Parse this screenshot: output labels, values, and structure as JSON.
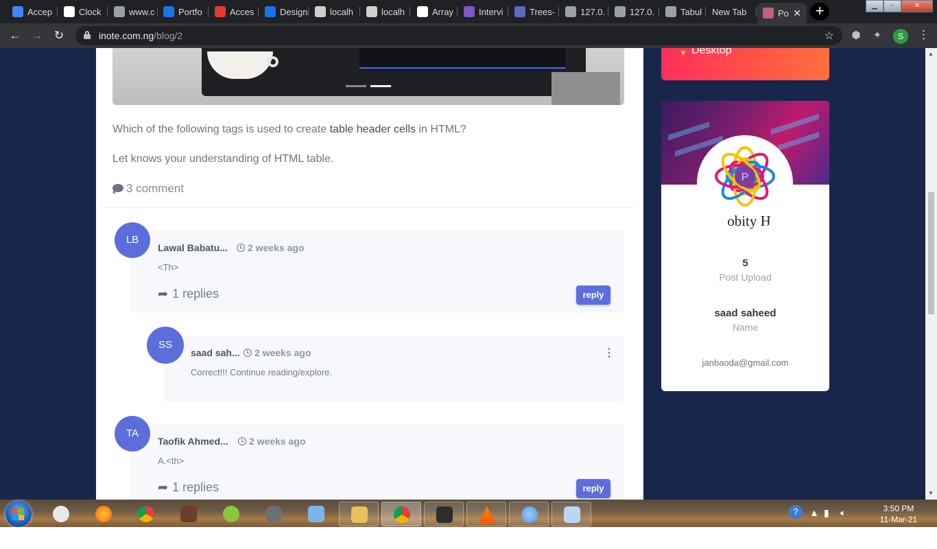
{
  "browser": {
    "tabs": [
      {
        "label": "Accep",
        "color": "#4285f4"
      },
      {
        "label": "Clock",
        "color": "#ffffff"
      },
      {
        "label": "www.c",
        "color": "#9aa0a6"
      },
      {
        "label": "Portfo",
        "color": "#1a73e8"
      },
      {
        "label": "Acces",
        "color": "#e53935"
      },
      {
        "label": "Design",
        "color": "#1a73e8"
      },
      {
        "label": "localh",
        "color": "#cfcfcf"
      },
      {
        "label": "localh",
        "color": "#cfcfcf"
      },
      {
        "label": "Array",
        "color": "#ffffff"
      },
      {
        "label": "Intervi",
        "color": "#7e57c2"
      },
      {
        "label": "Trees-",
        "color": "#5c6bc0"
      },
      {
        "label": "127.0.",
        "color": "#9aa0a6"
      },
      {
        "label": "127.0.",
        "color": "#9aa0a6"
      },
      {
        "label": "Tabul",
        "color": "#9aa0a6"
      },
      {
        "label": "New Tab",
        "color": ""
      },
      {
        "label": "Po",
        "color": "#c06080"
      }
    ],
    "new_tab_symbol": "+",
    "url_host": "inote.com.ng",
    "url_path": "/blog/2",
    "profile_initial": "S"
  },
  "post": {
    "question_prefix": "Which of the following tags is used to create ",
    "question_highlight": "table header cells",
    "question_suffix": " in HTML?",
    "description": "Let knows your understanding of HTML table.",
    "comment_count": "3 comment"
  },
  "comments": [
    {
      "initials": "LB",
      "name": "Lawal Babatu...",
      "time": "2 weeks ago",
      "text": "<Th>",
      "replies": "1 replies",
      "reply_label": "reply"
    },
    {
      "initials": "SS",
      "name": "saad sah...",
      "time": "2 weeks ago",
      "text": "Correct!!! Continue reading/explore."
    },
    {
      "initials": "TA",
      "name": "Taofik Ahmed...",
      "time": "2 weeks ago",
      "text": "A.<th>",
      "replies": "1 replies",
      "reply_label": "reply"
    }
  ],
  "sidebar": {
    "category_label": "Desktop",
    "logo_text": "obity H",
    "logo_letter": "P",
    "post_upload_value": "5",
    "post_upload_label": "Post Upload",
    "name_value": "saad saheed",
    "name_label": "Name",
    "email": "janbaoda@gmail.com"
  },
  "taskbar": {
    "time": "3:50 PM",
    "date": "11-Mar-21"
  },
  "colors": {
    "page_bg": "#19264b",
    "accent": "#5c6edb",
    "category_gradient_start": "#ff2e5a",
    "category_gradient_end": "#ff6f3c"
  }
}
